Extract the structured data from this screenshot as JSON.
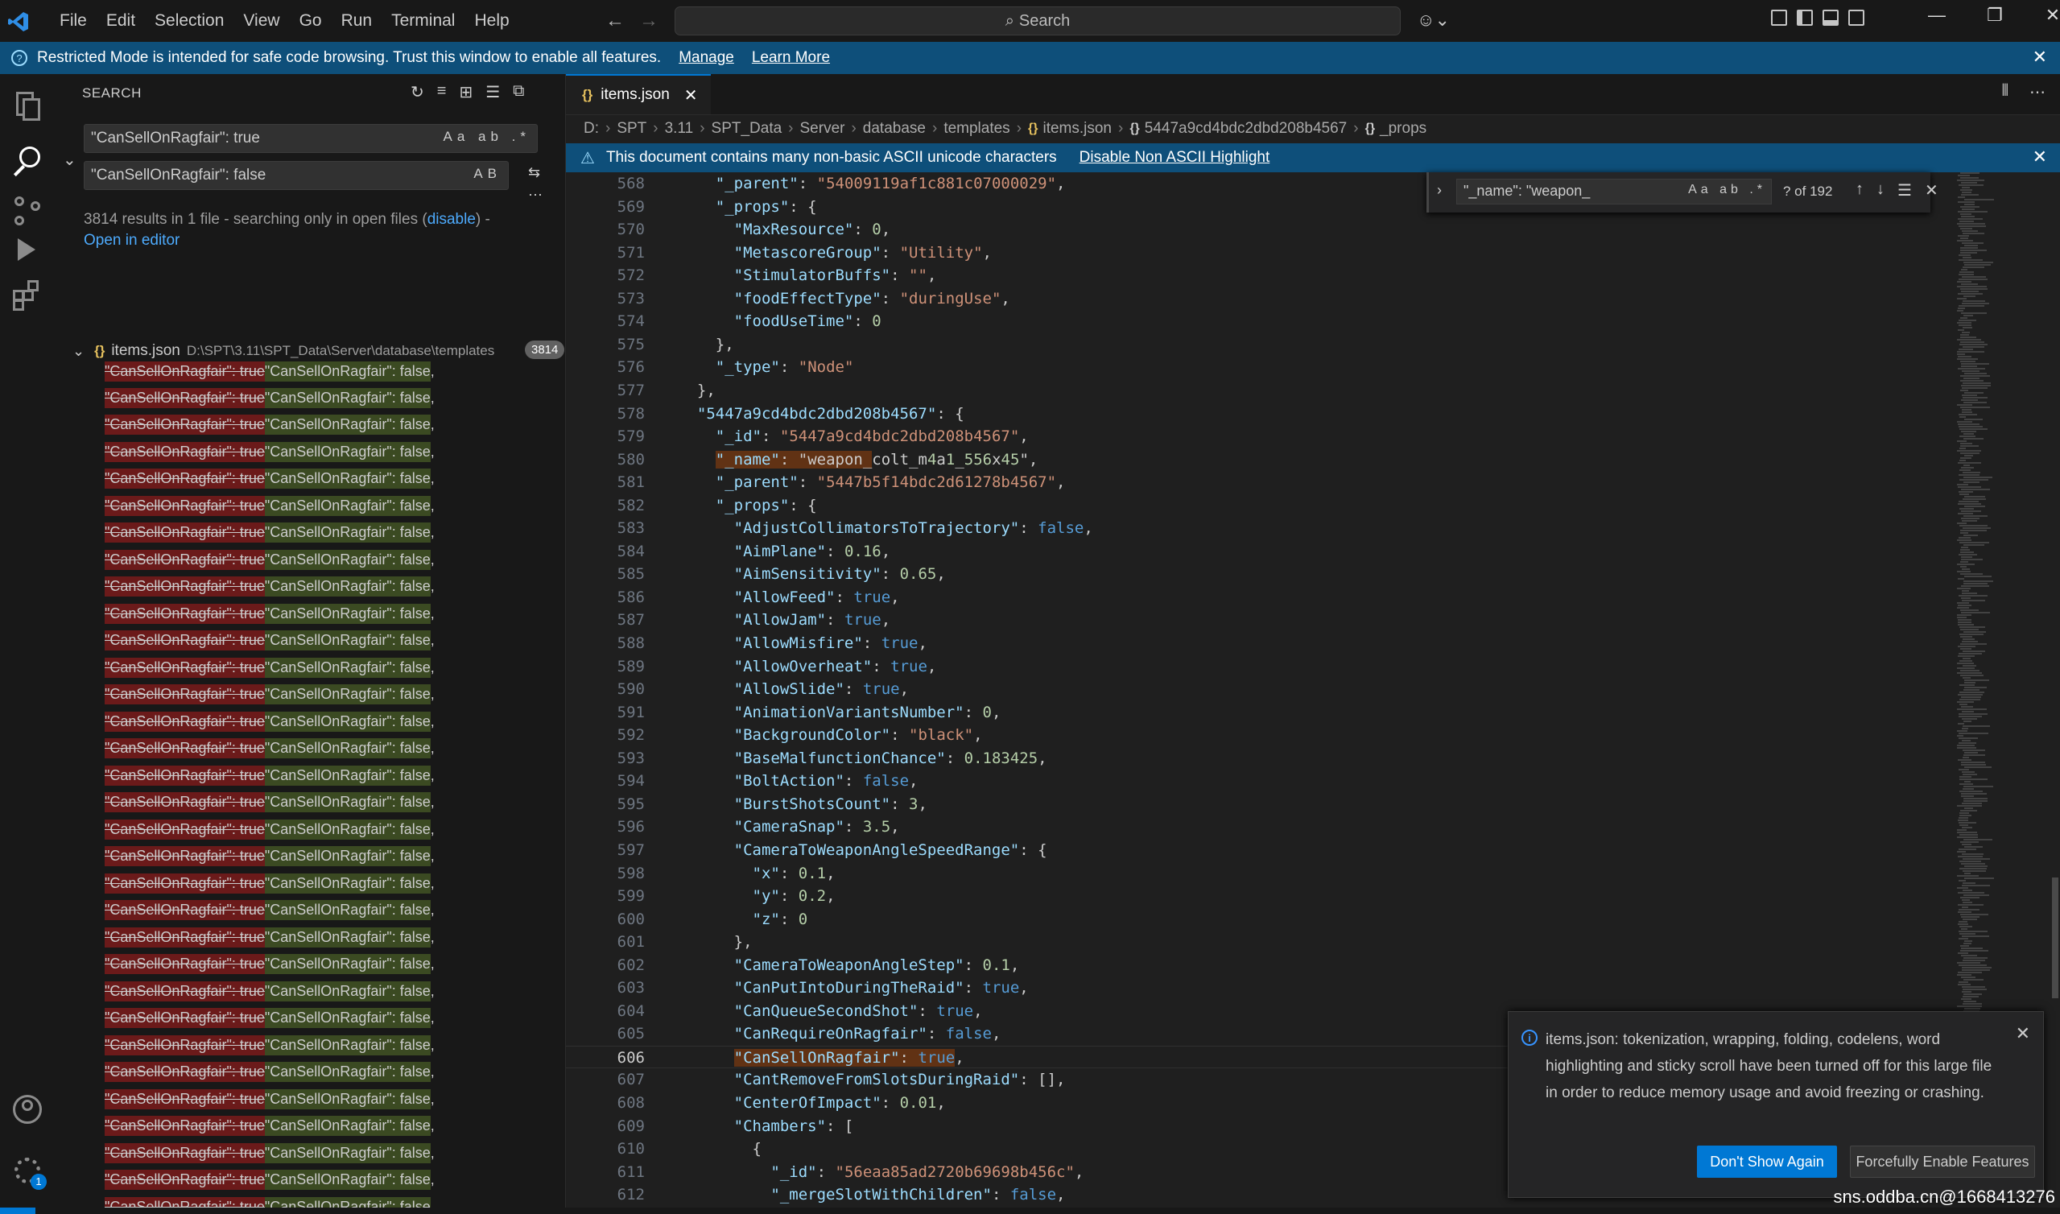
{
  "menu": [
    "File",
    "Edit",
    "Selection",
    "View",
    "Go",
    "Run",
    "Terminal",
    "Help"
  ],
  "command_center": {
    "label": "Search"
  },
  "restricted_banner": {
    "message": "Restricted Mode is intended for safe code browsing. Trust this window to enable all features.",
    "manage": "Manage",
    "learn_more": "Learn More"
  },
  "sidebar": {
    "title": "SEARCH",
    "search_value": "\"CanSellOnRagfair\": true",
    "search_options": "Aa ab .*",
    "replace_value": "\"CanSellOnRagfair\": false",
    "replace_option": "AB",
    "results_message": "3814 results in 1 file - searching only in open files (",
    "disable_link": "disable",
    "results_message_end": ") -",
    "open_in_editor": "Open in editor",
    "file": {
      "name": "items.json",
      "path": "D:\\SPT\\3.11\\SPT_Data\\Server\\database\\templates",
      "count": "3814"
    },
    "match": {
      "removed": "\"CanSellOnRagfair\": true",
      "added": "\"CanSellOnRagfair\": false",
      "rest": ","
    }
  },
  "tab": {
    "label": "items.json"
  },
  "breadcrumb": [
    "D:",
    "SPT",
    "3.11",
    "SPT_Data",
    "Server",
    "database",
    "templates",
    "items.json",
    "5447a9cd4bdc2dbd208b4567",
    "_props"
  ],
  "editor_banner": {
    "message": "This document contains many non-basic ASCII unicode characters",
    "action": "Disable Non ASCII Highlight"
  },
  "find_widget": {
    "value": "\"_name\": \"weapon_",
    "options": "Aa ab .*",
    "count": "? of 192"
  },
  "code_lines": [
    {
      "n": "568",
      "t": "    \"_parent\": \"54009119af1c881c07000029\","
    },
    {
      "n": "569",
      "t": "    \"_props\": {"
    },
    {
      "n": "570",
      "t": "      \"MaxResource\": 0,"
    },
    {
      "n": "571",
      "t": "      \"MetascoreGroup\": \"Utility\","
    },
    {
      "n": "572",
      "t": "      \"StimulatorBuffs\": \"\","
    },
    {
      "n": "573",
      "t": "      \"foodEffectType\": \"duringUse\","
    },
    {
      "n": "574",
      "t": "      \"foodUseTime\": 0"
    },
    {
      "n": "575",
      "t": "    },"
    },
    {
      "n": "576",
      "t": "    \"_type\": \"Node\""
    },
    {
      "n": "577",
      "t": "  },"
    },
    {
      "n": "578",
      "t": "  \"5447a9cd4bdc2dbd208b4567\": {"
    },
    {
      "n": "579",
      "t": "    \"_id\": \"5447a9cd4bdc2dbd208b4567\","
    },
    {
      "n": "580",
      "t": "    \"_name\": \"weapon_colt_m4a1_556x45\",",
      "hl": "\"_name\": \"weapon_"
    },
    {
      "n": "581",
      "t": "    \"_parent\": \"5447b5f14bdc2d61278b4567\","
    },
    {
      "n": "582",
      "t": "    \"_props\": {"
    },
    {
      "n": "583",
      "t": "      \"AdjustCollimatorsToTrajectory\": false,"
    },
    {
      "n": "584",
      "t": "      \"AimPlane\": 0.16,"
    },
    {
      "n": "585",
      "t": "      \"AimSensitivity\": 0.65,"
    },
    {
      "n": "586",
      "t": "      \"AllowFeed\": true,"
    },
    {
      "n": "587",
      "t": "      \"AllowJam\": true,"
    },
    {
      "n": "588",
      "t": "      \"AllowMisfire\": true,"
    },
    {
      "n": "589",
      "t": "      \"AllowOverheat\": true,"
    },
    {
      "n": "590",
      "t": "      \"AllowSlide\": true,"
    },
    {
      "n": "591",
      "t": "      \"AnimationVariantsNumber\": 0,"
    },
    {
      "n": "592",
      "t": "      \"BackgroundColor\": \"black\","
    },
    {
      "n": "593",
      "t": "      \"BaseMalfunctionChance\": 0.183425,"
    },
    {
      "n": "594",
      "t": "      \"BoltAction\": false,"
    },
    {
      "n": "595",
      "t": "      \"BurstShotsCount\": 3,"
    },
    {
      "n": "596",
      "t": "      \"CameraSnap\": 3.5,"
    },
    {
      "n": "597",
      "t": "      \"CameraToWeaponAngleSpeedRange\": {"
    },
    {
      "n": "598",
      "t": "        \"x\": 0.1,"
    },
    {
      "n": "599",
      "t": "        \"y\": 0.2,"
    },
    {
      "n": "600",
      "t": "        \"z\": 0"
    },
    {
      "n": "601",
      "t": "      },"
    },
    {
      "n": "602",
      "t": "      \"CameraToWeaponAngleStep\": 0.1,"
    },
    {
      "n": "603",
      "t": "      \"CanPutIntoDuringTheRaid\": true,"
    },
    {
      "n": "604",
      "t": "      \"CanQueueSecondShot\": true,"
    },
    {
      "n": "605",
      "t": "      \"CanRequireOnRagfair\": false,"
    },
    {
      "n": "606",
      "t": "      \"CanSellOnRagfair\": true,",
      "hl": "\"CanSellOnRagfair\": true",
      "cur": true
    },
    {
      "n": "607",
      "t": "      \"CantRemoveFromSlotsDuringRaid\": [],"
    },
    {
      "n": "608",
      "t": "      \"CenterOfImpact\": 0.01,"
    },
    {
      "n": "609",
      "t": "      \"Chambers\": ["
    },
    {
      "n": "610",
      "t": "        {"
    },
    {
      "n": "611",
      "t": "          \"_id\": \"56eaa85ad2720b69698b456c\","
    },
    {
      "n": "612",
      "t": "          \"_mergeSlotWithChildren\": false,"
    }
  ],
  "notification": {
    "message": "items.json: tokenization, wrapping, folding, codelens, word highlighting and sticky scroll have been turned off for this large file in order to reduce memory usage and avoid freezing or crashing.",
    "primary_button": "Don't Show Again",
    "secondary_button": "Forcefully Enable Features"
  },
  "watermark": "sns.oddba.cn@1668413276",
  "colors": {
    "accent": "#0078d4",
    "banner": "#0e4f7a",
    "removed": "#6b1a1a",
    "added": "#3b4a22",
    "match_highlight": "#613214"
  }
}
